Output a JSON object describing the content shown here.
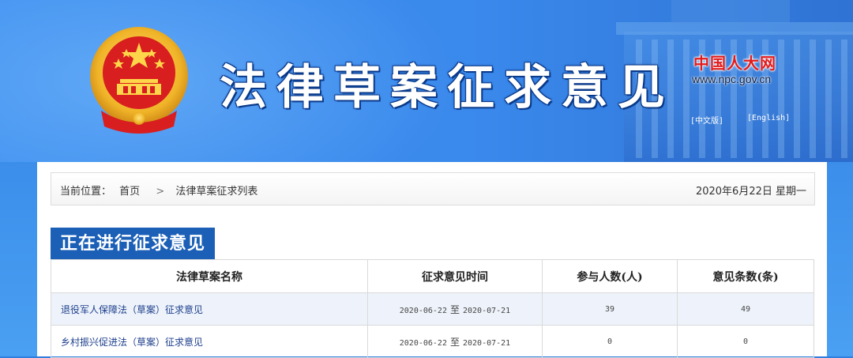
{
  "header": {
    "title": "法律草案征求意见",
    "npc_logo_text": "中国人大网",
    "npc_url": "www.npc.gov.cn",
    "lang_zh": "[中文版]",
    "lang_en": "[English]",
    "emblem_icon": "national-emblem-icon"
  },
  "breadcrumb": {
    "label": "当前位置：",
    "home": "首页",
    "separator": ">",
    "current": "法律草案征求列表"
  },
  "date": "2020年6月22日 星期一",
  "section": {
    "title": "正在进行征求意见"
  },
  "table": {
    "headers": [
      "法律草案名称",
      "征求意见时间",
      "参与人数(人)",
      "意见条数(条)"
    ],
    "rows": [
      {
        "name": "退役军人保障法（草案）征求意见",
        "start": "2020-06-22",
        "to": "至",
        "end": "2020-07-21",
        "participants": "39",
        "opinions": "49"
      },
      {
        "name": "乡村振兴促进法（草案）征求意见",
        "start": "2020-06-22",
        "to": "至",
        "end": "2020-07-21",
        "participants": "0",
        "opinions": "0"
      }
    ]
  },
  "colors": {
    "banner_blue": "#3a89ec",
    "tab_blue": "#1b5fb6",
    "logo_red": "#e31b1b",
    "row_alt": "#eef3fb"
  }
}
